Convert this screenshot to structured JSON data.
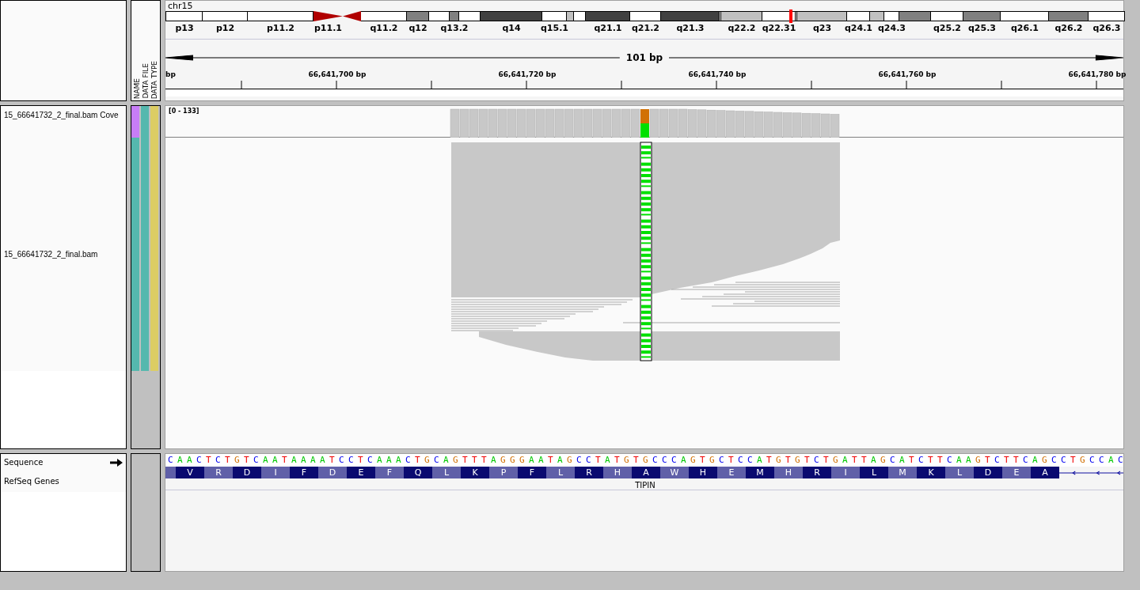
{
  "header": {
    "chromosome": "chr15",
    "attribute_headers": [
      "NAME",
      "DATA FILE",
      "DATA TYPE"
    ],
    "bands": [
      {
        "label": "p13",
        "kind": "gneg"
      },
      {
        "label": "p12",
        "kind": "gneg"
      },
      {
        "label": "p11.2",
        "kind": "gneg"
      },
      {
        "label": "p11.1",
        "kind": "acenp"
      },
      {
        "kind": "acenq"
      },
      {
        "label": "q11.2",
        "kind": "gneg"
      },
      {
        "label": "q12",
        "kind": "gpos50"
      },
      {
        "kind": "gneg"
      },
      {
        "label": "q13.2",
        "kind": "gpos50"
      },
      {
        "kind": "gneg"
      },
      {
        "label": "q14",
        "kind": "gpos75"
      },
      {
        "label": "q15.1",
        "kind": "gneg"
      },
      {
        "kind": "gpos25"
      },
      {
        "kind": "gneg"
      },
      {
        "label": "q21.1",
        "kind": "gpos75"
      },
      {
        "label": "q21.2",
        "kind": "gneg"
      },
      {
        "label": "q21.3",
        "kind": "gpos75"
      },
      {
        "kind": "gneg"
      },
      {
        "label": "q22.2",
        "kind": "gpos25"
      },
      {
        "label": "q22.31",
        "kind": "gneg"
      },
      {
        "kind": "gneg"
      },
      {
        "label": "q23",
        "kind": "gpos25"
      },
      {
        "label": "q24.1",
        "kind": "gneg"
      },
      {
        "kind": "gpos25"
      },
      {
        "label": "q24.3",
        "kind": "gneg"
      },
      {
        "kind": "gpos50"
      },
      {
        "label": "q25.2",
        "kind": "gneg"
      },
      {
        "label": "q25.3",
        "kind": "gpos50"
      },
      {
        "label": "q26.1",
        "kind": "gneg"
      },
      {
        "label": "q26.2",
        "kind": "gpos50"
      },
      {
        "label": "q26.3",
        "kind": "gneg"
      }
    ],
    "span": "101 bp",
    "ticks": [
      "bp",
      "66,641,700 bp",
      "66,641,720 bp",
      "66,641,740 bp",
      "66,641,760 bp",
      "66,641,780 bp"
    ]
  },
  "tracks": [
    {
      "name": "15_66641732_2_final.bam Cove",
      "kind": "coverage",
      "range": "[0 - 133]",
      "attributes": [
        {
          "color": "#c77df7"
        },
        {
          "color": "#55b8ae"
        },
        {
          "color": "#dccd64"
        }
      ]
    },
    {
      "name": "15_66641732_2_final.bam",
      "kind": "alignment",
      "attributes": [
        {
          "color": "#55b8ae"
        },
        {
          "color": "#55b8ae"
        },
        {
          "color": "#dccd64"
        }
      ]
    }
  ],
  "features": {
    "sequence": {
      "label": "Sequence",
      "bases": "CAACTCTGTCAATAAAATCCTCAAACTGCAGTTTAGGGAATAGCCTATGTGCCCAGTGCTCCATGTGTCTGATTAGCATCTTCAAGTCTTCAGCCTGCCAC"
    },
    "genes": {
      "label": "RefSeq Genes",
      "name": "TIPIN",
      "amino_acids": [
        "V",
        "R",
        "D",
        "I",
        "F",
        "D",
        "E",
        "F",
        "Q",
        "L",
        "K",
        "P",
        "F",
        "L",
        "R",
        "H",
        "A",
        "W",
        "H",
        "E",
        "M",
        "H",
        "R",
        "I",
        "L",
        "M",
        "K",
        "L",
        "D",
        "E",
        "A"
      ]
    }
  }
}
